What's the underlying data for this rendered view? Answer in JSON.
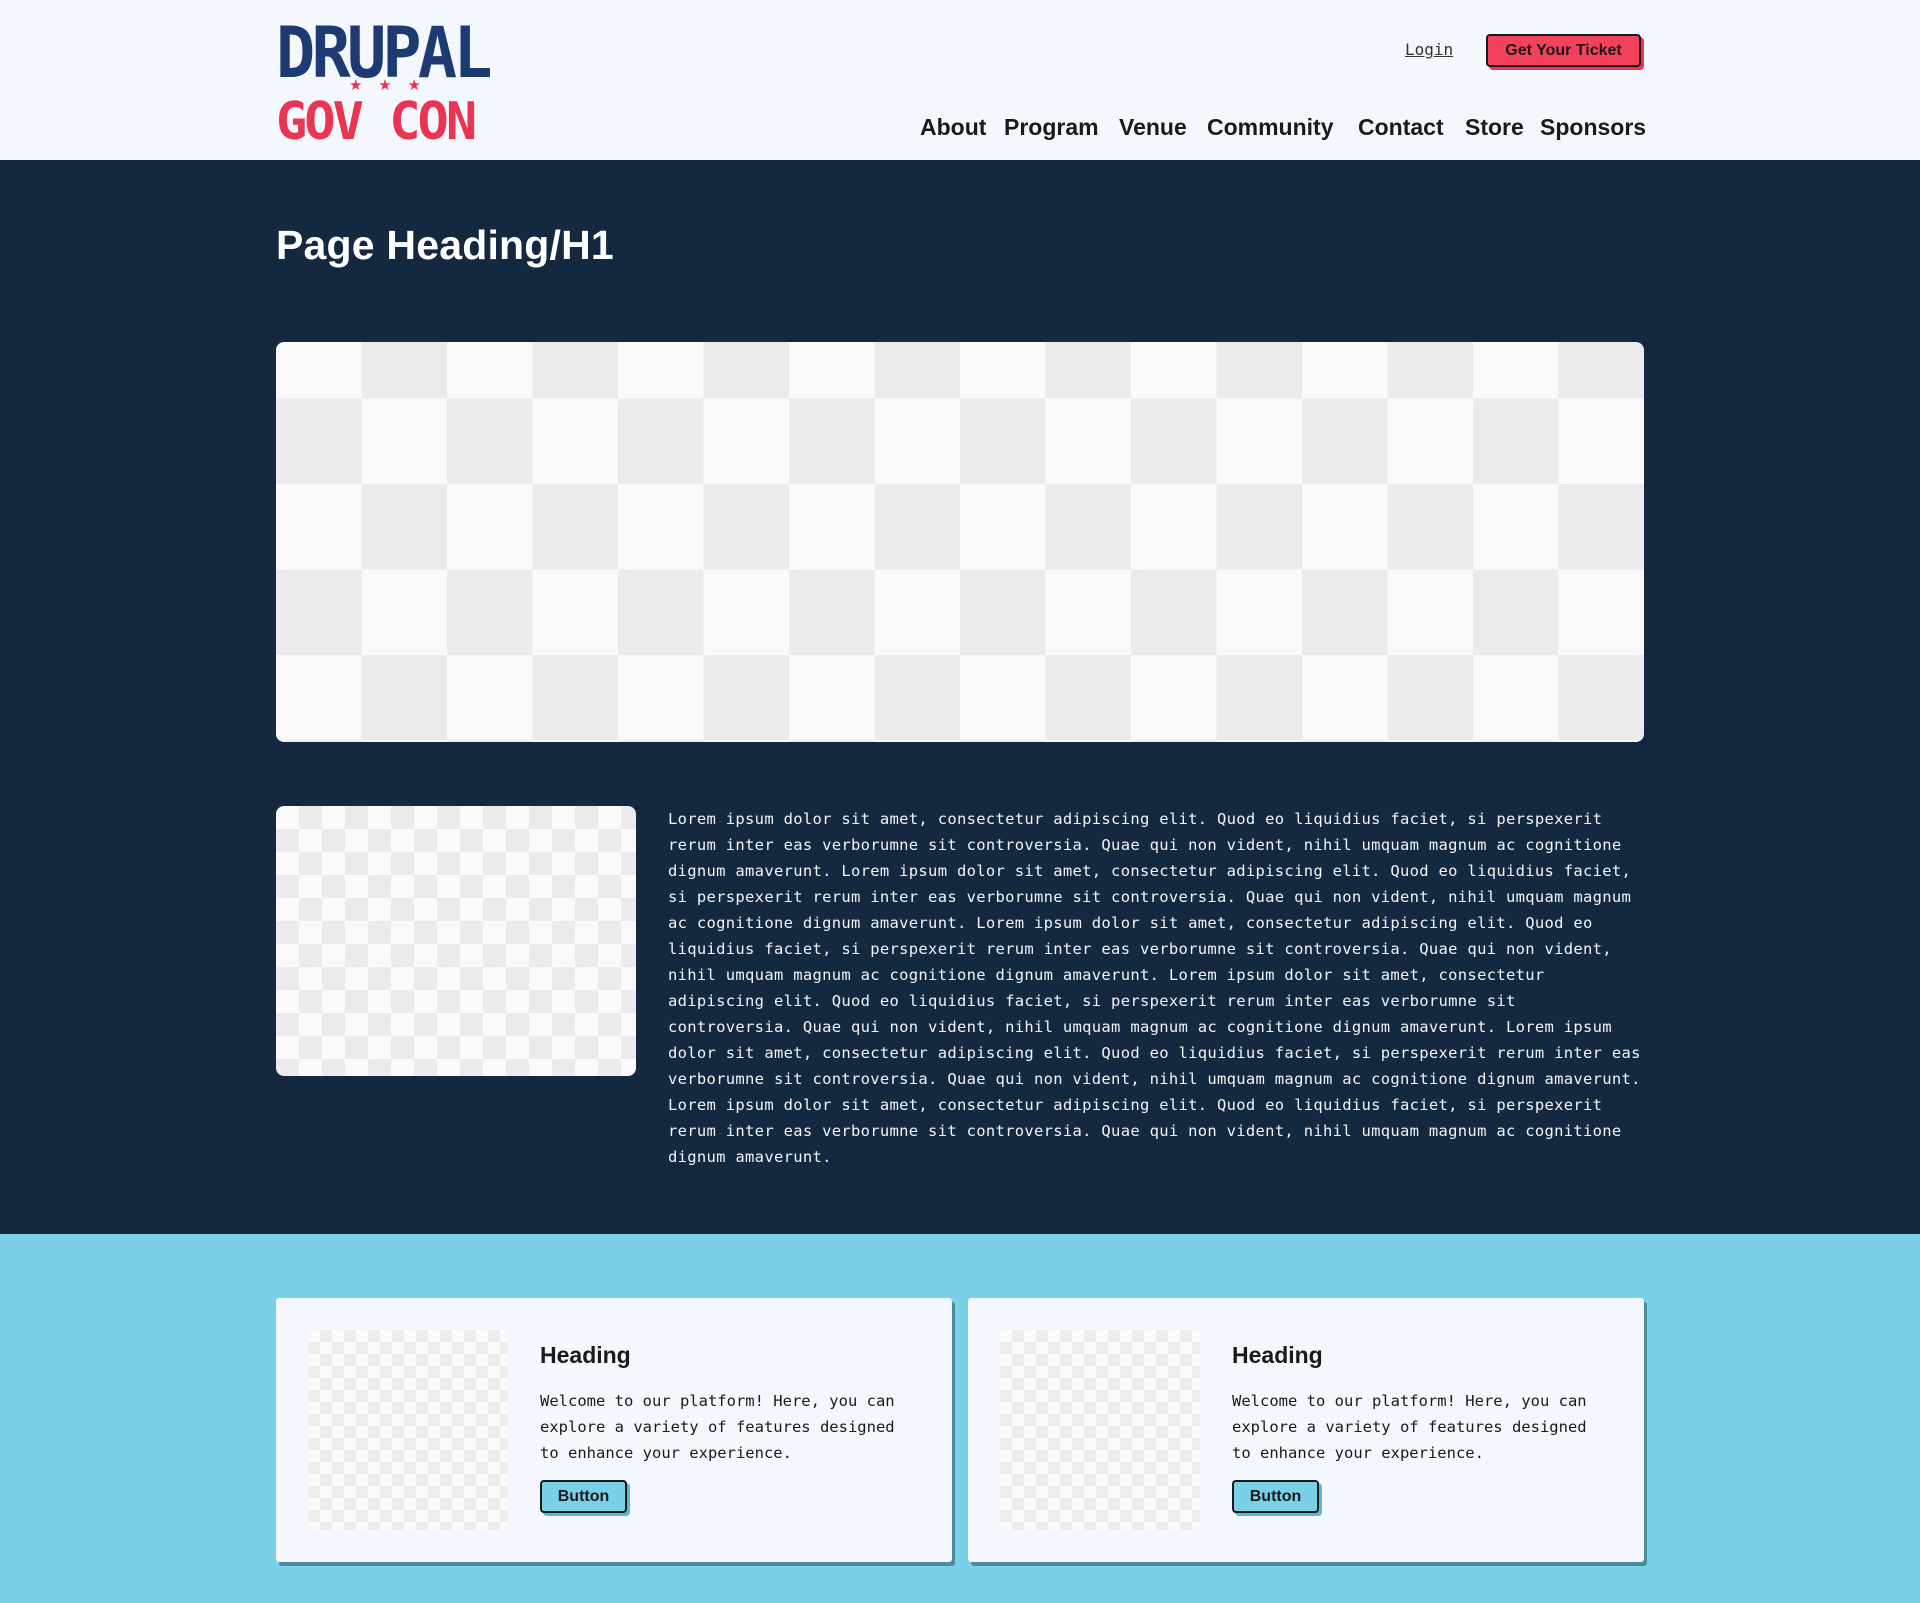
{
  "header": {
    "logo": {
      "line1": "DRUPAL",
      "stars": [
        "★",
        "★",
        "★"
      ],
      "line2": "GOV CON"
    },
    "login_label": "Login",
    "ticket_label": "Get Your Ticket",
    "nav": [
      "About",
      "Program",
      "Venue",
      "Community",
      "Contact",
      "Store",
      "Sponsors"
    ]
  },
  "main": {
    "heading": "Page Heading/H1",
    "body_text": "Lorem ipsum dolor sit amet, consectetur adipiscing elit. Quod eo liquidius faciet, si perspexerit rerum inter eas verborumne sit controversia. Quae qui non vident, nihil umquam magnum ac cognitione dignum amaverunt. Lorem ipsum dolor sit amet, consectetur adipiscing elit. Quod eo liquidius faciet, si perspexerit rerum inter eas verborumne sit controversia. Quae qui non vident, nihil umquam magnum ac cognitione dignum amaverunt. Lorem ipsum dolor sit amet, consectetur adipiscing elit. Quod eo liquidius faciet, si perspexerit rerum inter eas verborumne sit controversia. Quae qui non vident, nihil umquam magnum ac cognitione dignum amaverunt. Lorem ipsum dolor sit amet, consectetur adipiscing elit. Quod eo liquidius faciet, si perspexerit rerum inter eas verborumne sit controversia. Quae qui non vident, nihil umquam magnum ac cognitione dignum amaverunt. Lorem ipsum dolor sit amet, consectetur adipiscing elit. Quod eo liquidius faciet, si perspexerit rerum inter eas verborumne sit controversia. Quae qui non vident, nihil umquam magnum ac cognitione dignum amaverunt. Lorem ipsum dolor sit amet, consectetur adipiscing elit. Quod eo liquidius faciet, si perspexerit rerum inter eas verborumne sit controversia. Quae qui non vident, nihil umquam magnum ac cognitione dignum amaverunt."
  },
  "cards": [
    {
      "heading": "Heading",
      "text": "Welcome to our platform! Here, you can explore a variety of features designed to enhance your experience.",
      "button_label": "Button"
    },
    {
      "heading": "Heading",
      "text": "Welcome to our platform! Here, you can explore a variety of features designed to enhance your experience.",
      "button_label": "Button"
    }
  ],
  "colors": {
    "header_bg": "#f4f8fe",
    "dark_bg": "#142940",
    "accent_blue": "#7ad0e6",
    "accent_red": "#f4425d",
    "logo_navy": "#1e3a72"
  }
}
